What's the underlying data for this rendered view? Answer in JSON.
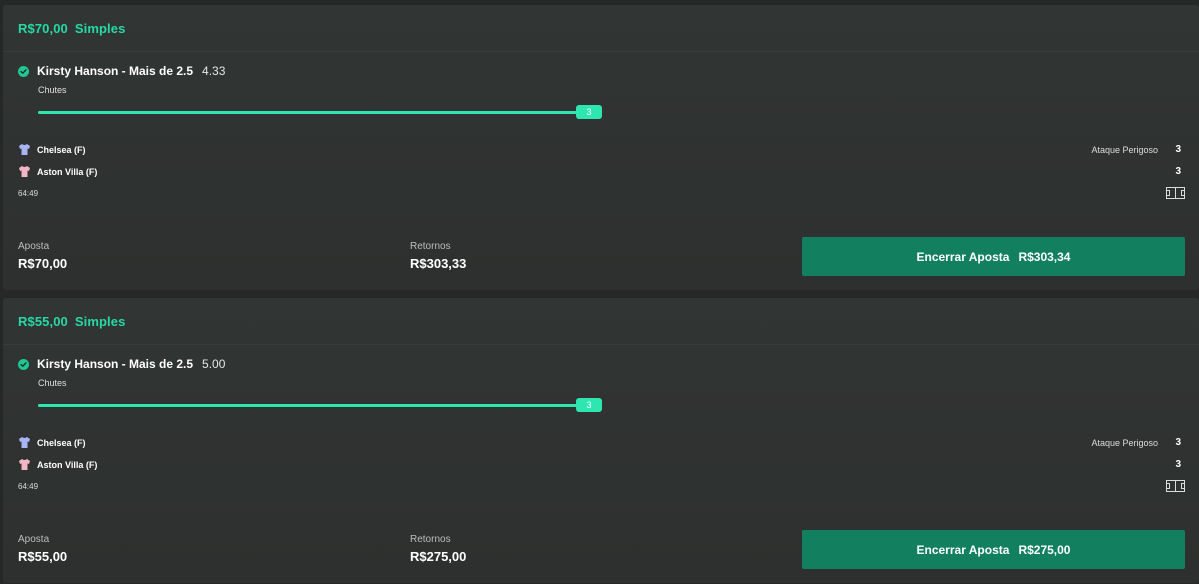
{
  "bets": [
    {
      "stake_header": "R$70,00",
      "type": "Simples",
      "selection": "Kirsty Hanson - Mais de 2.5",
      "odds": "4.33",
      "market": "Chutes",
      "progress_value": "3",
      "progress_fraction": 1.0,
      "team_home": "Chelsea (F)",
      "team_away": "Aston Villa (F)",
      "stat_label": "Ataque Perigoso",
      "stat_home": "3",
      "stat_away": "3",
      "clock": "64:49",
      "stake_label": "Aposta",
      "stake_value": "R$70,00",
      "returns_label": "Retornos",
      "returns_value": "R$303,33",
      "cashout_label": "Encerrar Aposta",
      "cashout_value": "R$303,34"
    },
    {
      "stake_header": "R$55,00",
      "type": "Simples",
      "selection": "Kirsty Hanson - Mais de 2.5",
      "odds": "5.00",
      "market": "Chutes",
      "progress_value": "3",
      "progress_fraction": 1.0,
      "team_home": "Chelsea (F)",
      "team_away": "Aston Villa (F)",
      "stat_label": "Ataque Perigoso",
      "stat_home": "3",
      "stat_away": "3",
      "clock": "64:49",
      "stake_label": "Aposta",
      "stake_value": "R$55,00",
      "returns_label": "Retornos",
      "returns_value": "R$275,00",
      "cashout_label": "Encerrar Aposta",
      "cashout_value": "R$275,00"
    }
  ],
  "colors": {
    "accent": "#26d9a3",
    "progress": "#2ee6b0",
    "cashout_button": "#12805f",
    "home_shirt": "#a9b4f5",
    "away_shirt": "#f2b6c6"
  },
  "icons": {
    "check": "check-circle-icon",
    "home_shirt": "shirt-icon",
    "away_shirt": "shirt-icon",
    "pitch": "pitch-icon"
  }
}
